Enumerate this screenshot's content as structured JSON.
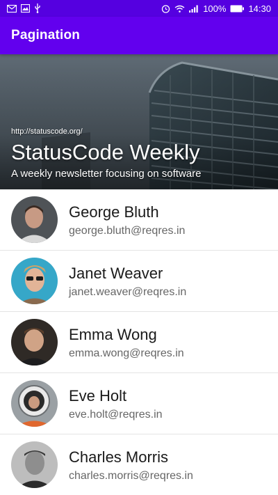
{
  "statusbar": {
    "left_icons": [
      "mail-icon",
      "image-icon",
      "usb-icon"
    ],
    "right_icons": [
      "alarm-icon",
      "wifi-icon",
      "signal-icon",
      "battery-icon"
    ],
    "battery": "100%",
    "time": "14:30"
  },
  "appbar": {
    "title": "Pagination",
    "color": "#6200ee"
  },
  "hero": {
    "url": "http://statuscode.org/",
    "title": "StatusCode Weekly",
    "subtitle": "A weekly newsletter focusing on software"
  },
  "users": [
    {
      "name": "George Bluth",
      "email": "george.bluth@reqres.in",
      "avatar": "avatar-george"
    },
    {
      "name": "Janet Weaver",
      "email": "janet.weaver@reqres.in",
      "avatar": "avatar-janet"
    },
    {
      "name": "Emma Wong",
      "email": "emma.wong@reqres.in",
      "avatar": "avatar-emma"
    },
    {
      "name": "Eve Holt",
      "email": "eve.holt@reqres.in",
      "avatar": "avatar-eve"
    },
    {
      "name": "Charles Morris",
      "email": "charles.morris@reqres.in",
      "avatar": "avatar-charles"
    }
  ]
}
